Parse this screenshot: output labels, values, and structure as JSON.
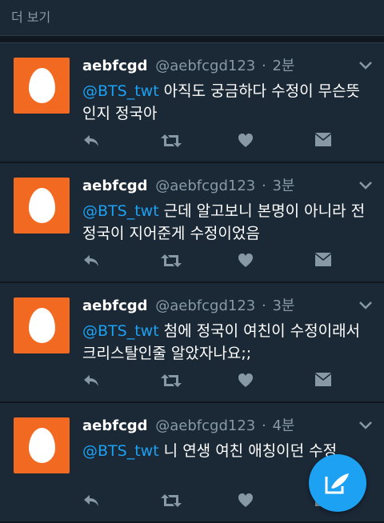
{
  "more": {
    "label": "더 보기"
  },
  "colors": {
    "background": "#141d26",
    "card": "#1b2836",
    "accent": "#1da1f2",
    "avatar": "#f26a22",
    "muted": "#8899a6"
  },
  "icons": {
    "reply": "reply-icon",
    "retweet": "retweet-icon",
    "like": "heart-icon",
    "dm": "envelope-icon",
    "menu": "chevron-down-icon",
    "compose": "compose-tweet-icon"
  },
  "tweets": [
    {
      "name": "aebfcgd",
      "handle": "@aebfcgd123",
      "sep": "·",
      "time": "2분",
      "mention": "@BTS_twt",
      "text": " 아직도 궁금하다 수정이 무슨뜻인지 정국아"
    },
    {
      "name": "aebfcgd",
      "handle": "@aebfcgd123",
      "sep": "·",
      "time": "3분",
      "mention": "@BTS_twt",
      "text": " 근데 알고보니 본명이 아니라 전정국이 지어준게 수정이었음"
    },
    {
      "name": "aebfcgd",
      "handle": "@aebfcgd123",
      "sep": "·",
      "time": "3분",
      "mention": "@BTS_twt",
      "text": " 첨에 정국이 여친이 수정이래서 크리스탈인줄 알았자나요;;"
    },
    {
      "name": "aebfcgd",
      "handle": "@aebfcgd123",
      "sep": "·",
      "time": "4분",
      "mention": "@BTS_twt",
      "text": " 니 연생 여친 애칭이던 수정"
    }
  ]
}
